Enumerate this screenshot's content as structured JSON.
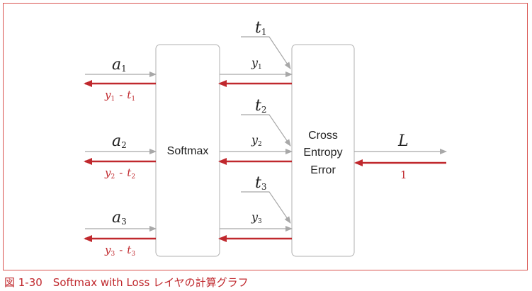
{
  "caption": "図 1-30　Softmax with Loss レイヤの計算グラフ",
  "nodes": {
    "softmax": "Softmax",
    "cross_entropy": [
      "Cross",
      "Entropy",
      "Error"
    ]
  },
  "inputs": [
    {
      "a": "a",
      "sub": "1",
      "y": "y",
      "t": "t",
      "grad_y": "y",
      "grad_t": "t",
      "minus": "-"
    },
    {
      "a": "a",
      "sub": "2",
      "y": "y",
      "t": "t",
      "grad_y": "y",
      "grad_t": "t",
      "minus": "-"
    },
    {
      "a": "a",
      "sub": "3",
      "y": "y",
      "t": "t",
      "grad_y": "y",
      "grad_t": "t",
      "minus": "-"
    }
  ],
  "output": {
    "label": "L",
    "grad": "1"
  },
  "colors": {
    "forward": "#a8a8a8",
    "backward": "#c0282d",
    "frame": "#d9534f"
  }
}
